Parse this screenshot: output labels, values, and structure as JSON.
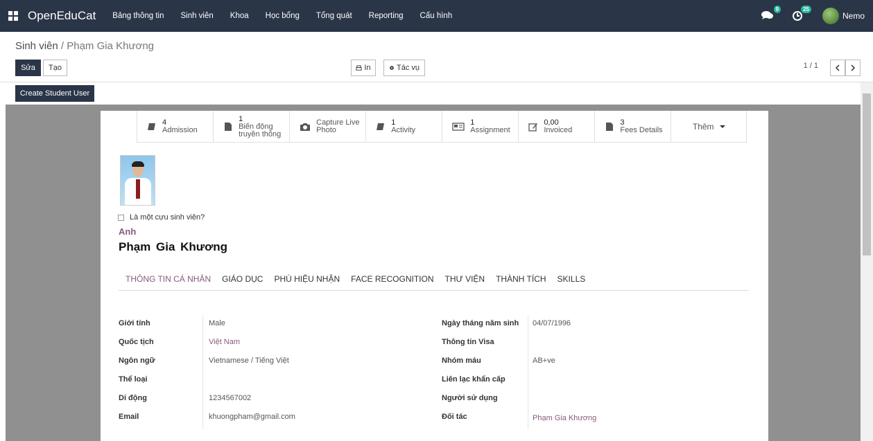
{
  "navbar": {
    "brand": "OpenEduCat",
    "menu": [
      "Bảng thông tin",
      "Sinh viên",
      "Khoa",
      "Học bổng",
      "Tổng quát",
      "Reporting",
      "Cấu hình"
    ],
    "messages_count": "9",
    "activities_count": "25",
    "user_name": "Nemo"
  },
  "breadcrumb": {
    "parent": "Sinh viên",
    "separator": " / ",
    "current": "Phạm Gia Khương"
  },
  "buttons": {
    "edit": "Sửa",
    "create": "Tạo",
    "print": "In",
    "action": "Tác vụ",
    "create_student_user": "Create Student User"
  },
  "pager": {
    "text": "1 / 1"
  },
  "smart_buttons": [
    {
      "value": "4",
      "label": "Admission",
      "icon": "book-icon"
    },
    {
      "value": "1",
      "label": "Biến động truyền thông",
      "icon": "file-icon"
    },
    {
      "value": "",
      "label": "Capture Live Photo",
      "icon": "camera-icon"
    },
    {
      "value": "1",
      "label": "Activity",
      "icon": "book-icon"
    },
    {
      "value": "1",
      "label": "Assignment",
      "icon": "newspaper-icon"
    },
    {
      "value": "0,00",
      "label": "Invoiced",
      "icon": "pencil-square-icon"
    },
    {
      "value": "3",
      "label": "Fees Details",
      "icon": "file-icon"
    },
    {
      "value": "",
      "label": "Thêm",
      "icon": "caret-down-icon"
    }
  ],
  "student": {
    "alumni_label": "Là một cựu sinh viên?",
    "first_name": "Anh",
    "full_name": "Phạm Gia Khương"
  },
  "tabs": [
    "THÔNG TIN CÁ NHÂN",
    "GIÁO DỤC",
    "PHÙ HIỆU NHẬN",
    "FACE RECOGNITION",
    "THƯ VIỆN",
    "THÀNH TÍCH",
    "SKILLS"
  ],
  "left_fields": [
    {
      "label": "Giới tính",
      "value": "Male"
    },
    {
      "label": "Quốc tịch",
      "value": "Việt Nam"
    },
    {
      "label": "Ngôn ngữ",
      "value": "Vietnamese / Tiếng Việt"
    },
    {
      "label": "Thể loại",
      "value": ""
    },
    {
      "label": "Di động",
      "value": "1234567002"
    },
    {
      "label": "Email",
      "value": "khuongpham@gmail.com"
    }
  ],
  "right_fields": [
    {
      "label": "Ngày tháng năm sinh",
      "value": "04/07/1996"
    },
    {
      "label": "Thông tin Visa",
      "value": ""
    },
    {
      "label": "Nhóm máu",
      "value": "AB+ve"
    },
    {
      "label": "Liên lạc khẩn cấp",
      "value": ""
    },
    {
      "label": "Người sử dụng",
      "value": ""
    },
    {
      "label": "Đối tác",
      "value": "Phạm Gia Khương"
    }
  ],
  "colors": {
    "navbar": "#2b3548",
    "accent": "#875a7b",
    "badge": "#21b799"
  }
}
